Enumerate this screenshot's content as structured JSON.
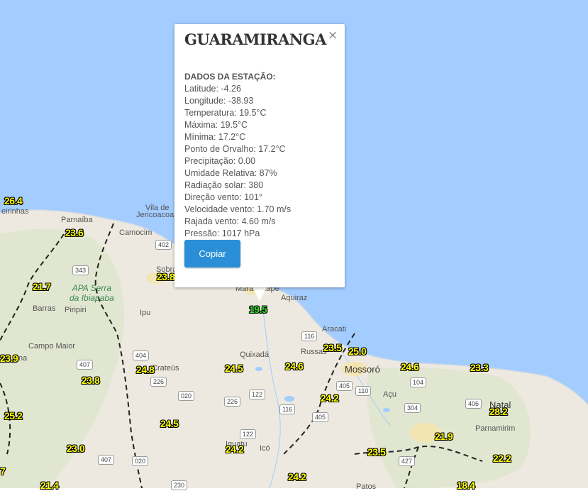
{
  "popup": {
    "title": "GUARAMIRANGA",
    "close_glyph": "×",
    "heading": "DADOS DA ESTAÇÃO:",
    "lines": [
      "Latitude: -4.26",
      "Longitude: -38.93",
      "Temperatura: 19.5°C",
      "Máxima: 19.5°C",
      "Mínima: 17.2°C",
      "Ponto de Orvalho: 17.2°C",
      "Precipitação: 0.00",
      "Umidade Relativa: 87%",
      "Radiação solar: 380",
      "Direção vento: 101°",
      "Velocidade vento: 1.70 m/s",
      "Rajada vento: 4.60 m/s",
      "Pressão: 1017 hPa"
    ],
    "copy_label": "Copiar"
  },
  "colors": {
    "ocean": "#a3ccff",
    "land": "#ede9e0",
    "temp_default": "#ffff00",
    "temp_selected": "#35e52a",
    "button": "#2a8fd6"
  },
  "stations": [
    {
      "label": "26.4"
    },
    {
      "label": "23.6"
    },
    {
      "label": "21.7"
    },
    {
      "label": "23.9"
    },
    {
      "label": "23.8"
    },
    {
      "label": "25.2"
    },
    {
      "label": "24.8"
    },
    {
      "label": "24.5"
    },
    {
      "label": "24.5"
    },
    {
      "label": "23.0"
    },
    {
      "label": "24.2"
    },
    {
      "label": "24.6"
    },
    {
      "label": "23.5"
    },
    {
      "label": "25.0"
    },
    {
      "label": "24.2"
    },
    {
      "label": "24.6"
    },
    {
      "label": "23.3"
    },
    {
      "label": "28.2"
    },
    {
      "label": "21.9"
    },
    {
      "label": "23.5"
    },
    {
      "label": "24.2"
    },
    {
      "label": "22.2"
    },
    {
      "label": "19.5",
      "selected": true
    },
    {
      "label": "23.8"
    },
    {
      "label": "21.4"
    },
    {
      "label": "18.4"
    },
    {
      "label": "7"
    }
  ],
  "places": {
    "ireirinhas": "eirinhas",
    "parnaiba": "Parnaíba",
    "camocim": "Camocim",
    "vila_de": "Vila de",
    "jericoacoara": "Jericoacoara",
    "sobral": "Sobral",
    "apa_line1": "APA Serra",
    "apa_line2": "da Ibiapaba",
    "barras": "Barras",
    "piripiri": "Piripiri",
    "ipu": "Ipu",
    "maranguape": "Maranguape",
    "aquiraz": "Aquiraz",
    "aracati": "Aracati",
    "russas": "Russas",
    "quixada": "Quixadá",
    "campo_maior": "Campo Maior",
    "teresina": "na",
    "mossoro": "Mossoró",
    "acu": "Açu",
    "natal": "Natal",
    "parnamirim": "Parnamirim",
    "crateus": "Crateús",
    "iguatu": "Iguatu",
    "ico": "Icó",
    "patos": "Patos"
  },
  "roads": [
    "402",
    "343",
    "404",
    "407",
    "226",
    "020",
    "122",
    "116",
    "116",
    "405",
    "110",
    "104",
    "304",
    "406",
    "405",
    "226",
    "122",
    "407",
    "020",
    "230",
    "427"
  ]
}
